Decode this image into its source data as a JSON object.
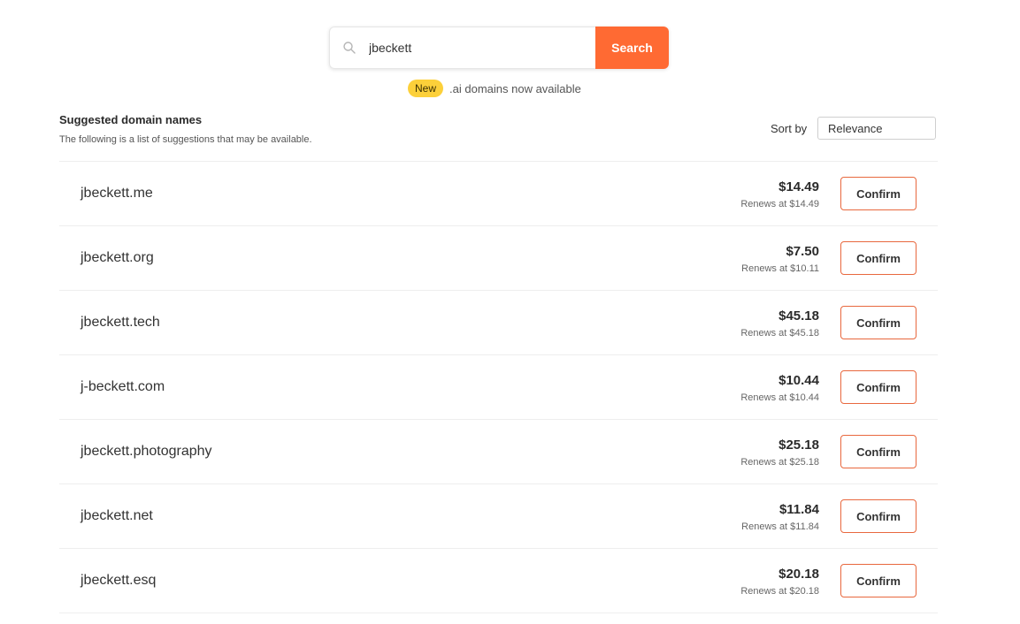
{
  "search": {
    "value": "jbeckett",
    "button_label": "Search"
  },
  "promo": {
    "badge": "New",
    "text": ".ai domains now available"
  },
  "list": {
    "title": "Suggested domain names",
    "subtitle": "The following is a list of suggestions that may be available.",
    "sort_label": "Sort by",
    "sort_value": "Relevance"
  },
  "domains": [
    {
      "name": "jbeckett.me",
      "price": "$14.49",
      "renews": "Renews at $14.49",
      "action": "Confirm"
    },
    {
      "name": "jbeckett.org",
      "price": "$7.50",
      "renews": "Renews at $10.11",
      "action": "Confirm"
    },
    {
      "name": "jbeckett.tech",
      "price": "$45.18",
      "renews": "Renews at $45.18",
      "action": "Confirm"
    },
    {
      "name": "j-beckett.com",
      "price": "$10.44",
      "renews": "Renews at $10.44",
      "action": "Confirm"
    },
    {
      "name": "jbeckett.photography",
      "price": "$25.18",
      "renews": "Renews at $25.18",
      "action": "Confirm"
    },
    {
      "name": "jbeckett.net",
      "price": "$11.84",
      "renews": "Renews at $11.84",
      "action": "Confirm"
    },
    {
      "name": "jbeckett.esq",
      "price": "$20.18",
      "renews": "Renews at $20.18",
      "action": "Confirm"
    }
  ],
  "colors": {
    "accent": "#ff6a33",
    "badge": "#fcd03a",
    "confirm_border": "#e8683e"
  },
  "icons": {
    "search": "search-icon"
  }
}
